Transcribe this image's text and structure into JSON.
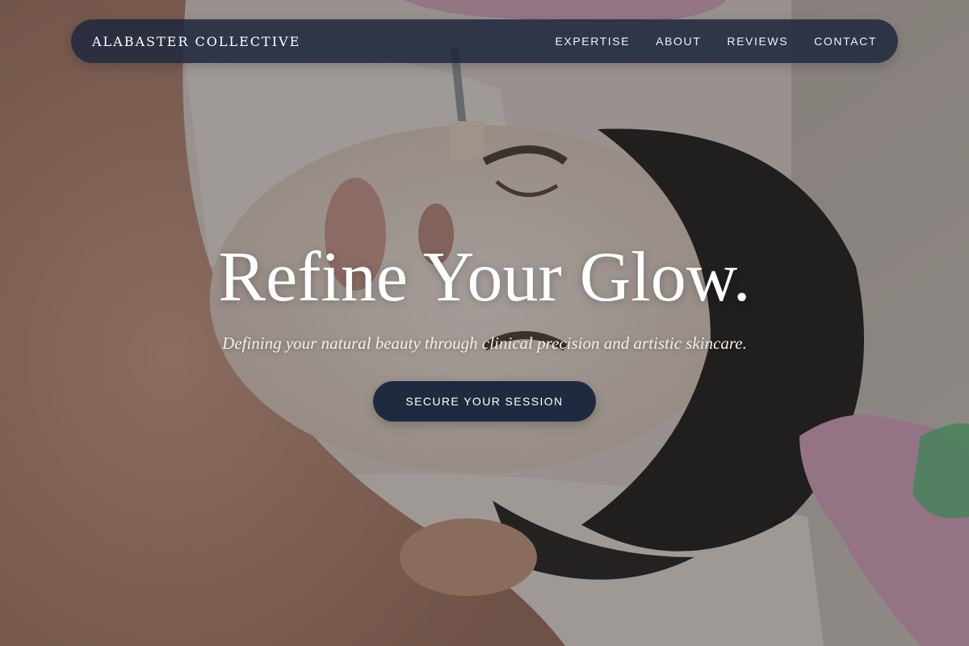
{
  "nav": {
    "brand": "ALABASTER COLLECTIVE",
    "links": [
      {
        "label": "EXPERTISE"
      },
      {
        "label": "ABOUT"
      },
      {
        "label": "REVIEWS"
      },
      {
        "label": "CONTACT"
      }
    ]
  },
  "hero": {
    "title": "Refine Your Glow.",
    "subtitle": "Defining your natural beauty through clinical precision and artistic skincare.",
    "cta_label": "SECURE YOUR SESSION",
    "image_subject": "facial-treatment-photo"
  },
  "colors": {
    "nav_bg": "#1e283c",
    "cta_bg": "#1e2a40",
    "text_light": "#ffffff"
  }
}
